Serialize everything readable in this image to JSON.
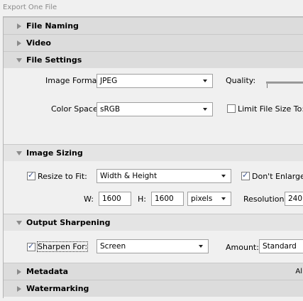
{
  "window": {
    "title": "Export One File"
  },
  "sections": {
    "file_naming": "File Naming",
    "video": "Video",
    "file_settings": "File Settings",
    "image_sizing": "Image Sizing",
    "output_sharpening": "Output Sharpening",
    "metadata": "Metadata",
    "watermarking": "Watermarking"
  },
  "file_settings": {
    "image_format_label": "Image Format:",
    "image_format_value": "JPEG",
    "quality_label": "Quality:",
    "color_space_label": "Color Space:",
    "color_space_value": "sRGB",
    "limit_size_label": "Limit File Size To:",
    "limit_size_checked": false
  },
  "image_sizing": {
    "resize_label": "Resize to Fit:",
    "resize_checked": true,
    "resize_value": "Width & Height",
    "dont_enlarge_label": "Don't Enlarge",
    "dont_enlarge_checked": true,
    "w_label": "W:",
    "w_value": "1600",
    "h_label": "H:",
    "h_value": "1600",
    "unit_value": "pixels",
    "resolution_label": "Resolution:",
    "resolution_value": "240"
  },
  "output_sharpening": {
    "sharpen_label": "Sharpen For:",
    "sharpen_checked": true,
    "sharpen_value": "Screen",
    "amount_label": "Amount:",
    "amount_value": "Standard"
  },
  "metadata_right_text": "Al"
}
